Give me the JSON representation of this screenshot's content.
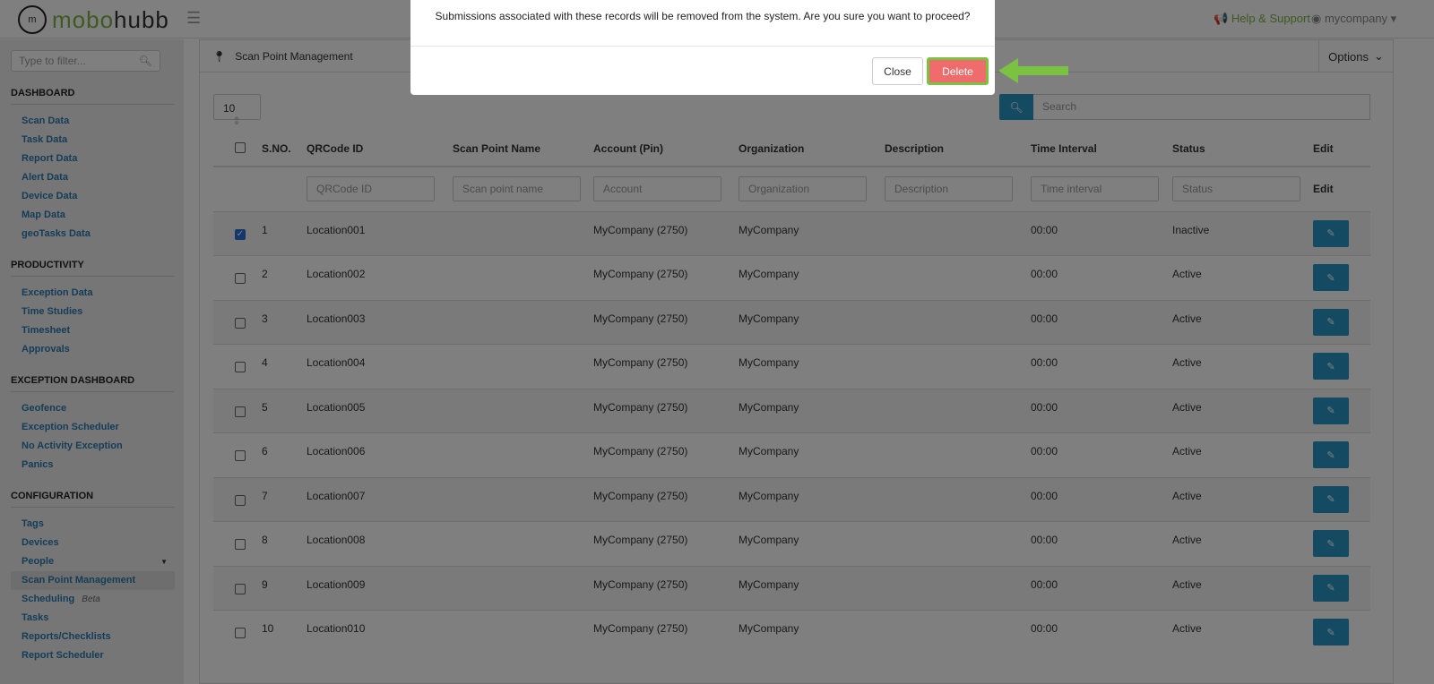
{
  "app": {
    "logo_mark": "m",
    "logo_green": "mobo",
    "logo_dark": "hubb",
    "help": "Help & Support",
    "user": "mycompany"
  },
  "sidebar": {
    "filter_placeholder": "Type to filter...",
    "sections": [
      {
        "title": "DASHBOARD",
        "items": [
          "Scan Data",
          "Task Data",
          "Report Data",
          "Alert Data",
          "Device Data",
          "Map Data",
          "geoTasks Data"
        ]
      },
      {
        "title": "PRODUCTIVITY",
        "items": [
          "Exception Data",
          "Time Studies",
          "Timesheet",
          "Approvals"
        ]
      },
      {
        "title": "EXCEPTION DASHBOARD",
        "items": [
          "Geofence",
          "Exception Scheduler",
          "No Activity Exception",
          "Panics"
        ]
      },
      {
        "title": "CONFIGURATION",
        "items": [
          "Tags",
          "Devices",
          "People",
          "Scan Point Management",
          "Scheduling",
          "Tasks",
          "Reports/Checklists",
          "Report Scheduler"
        ]
      }
    ],
    "beta_label": "Beta",
    "active_item": "Scan Point Management"
  },
  "main": {
    "title": "Scan Point Management",
    "options": "Options",
    "page_size": "10",
    "search_placeholder": "Search",
    "columns": [
      "S.NO.",
      "QRCode ID",
      "Scan Point Name",
      "Account (Pin)",
      "Organization",
      "Description",
      "Time Interval",
      "Status",
      "Edit"
    ],
    "filters": [
      "QRCode ID",
      "Scan point name",
      "Account",
      "Organization",
      "Description",
      "Time interval",
      "Status"
    ],
    "filter_edit": "Edit",
    "rows": [
      {
        "sno": "1",
        "qr": "Location001",
        "name": "",
        "account": "MyCompany (2750)",
        "org": "MyCompany",
        "desc": "",
        "time": "00:00",
        "status": "Inactive",
        "checked": true
      },
      {
        "sno": "2",
        "qr": "Location002",
        "name": "",
        "account": "MyCompany (2750)",
        "org": "MyCompany",
        "desc": "",
        "time": "00:00",
        "status": "Active",
        "checked": false
      },
      {
        "sno": "3",
        "qr": "Location003",
        "name": "",
        "account": "MyCompany (2750)",
        "org": "MyCompany",
        "desc": "",
        "time": "00:00",
        "status": "Active",
        "checked": false
      },
      {
        "sno": "4",
        "qr": "Location004",
        "name": "",
        "account": "MyCompany (2750)",
        "org": "MyCompany",
        "desc": "",
        "time": "00:00",
        "status": "Active",
        "checked": false
      },
      {
        "sno": "5",
        "qr": "Location005",
        "name": "",
        "account": "MyCompany (2750)",
        "org": "MyCompany",
        "desc": "",
        "time": "00:00",
        "status": "Active",
        "checked": false
      },
      {
        "sno": "6",
        "qr": "Location006",
        "name": "",
        "account": "MyCompany (2750)",
        "org": "MyCompany",
        "desc": "",
        "time": "00:00",
        "status": "Active",
        "checked": false
      },
      {
        "sno": "7",
        "qr": "Location007",
        "name": "",
        "account": "MyCompany (2750)",
        "org": "MyCompany",
        "desc": "",
        "time": "00:00",
        "status": "Active",
        "checked": false
      },
      {
        "sno": "8",
        "qr": "Location008",
        "name": "",
        "account": "MyCompany (2750)",
        "org": "MyCompany",
        "desc": "",
        "time": "00:00",
        "status": "Active",
        "checked": false
      },
      {
        "sno": "9",
        "qr": "Location009",
        "name": "",
        "account": "MyCompany (2750)",
        "org": "MyCompany",
        "desc": "",
        "time": "00:00",
        "status": "Active",
        "checked": false
      },
      {
        "sno": "10",
        "qr": "Location010",
        "name": "",
        "account": "MyCompany (2750)",
        "org": "MyCompany",
        "desc": "",
        "time": "00:00",
        "status": "Active",
        "checked": false
      }
    ]
  },
  "modal": {
    "message": "Submissions associated with these records will be removed from the system. Are you sure you want to proceed?",
    "close": "Close",
    "delete": "Delete"
  },
  "colors": {
    "brand_green": "#7cb342",
    "accent_blue": "#2b97c4",
    "delete_red": "#f06b6b",
    "highlight_green": "#7cc242"
  }
}
